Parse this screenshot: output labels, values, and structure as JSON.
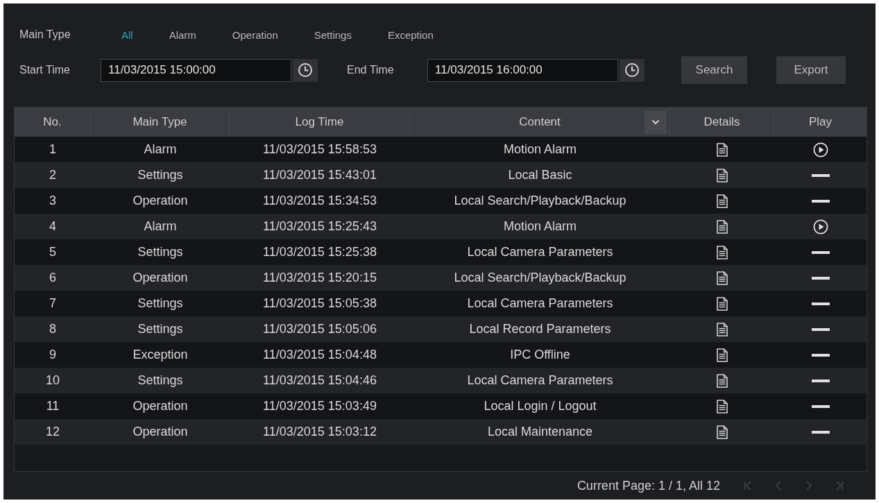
{
  "filter": {
    "label": "Main Type",
    "options": [
      {
        "label": "All",
        "selected": true
      },
      {
        "label": "Alarm",
        "selected": false
      },
      {
        "label": "Operation",
        "selected": false
      },
      {
        "label": "Settings",
        "selected": false
      },
      {
        "label": "Exception",
        "selected": false
      }
    ]
  },
  "time_range": {
    "start_label": "Start Time",
    "start_value": "11/03/2015 15:00:00",
    "end_label": "End Time",
    "end_value": "11/03/2015 16:00:00"
  },
  "buttons": [
    "Search",
    "Export"
  ],
  "table": {
    "columns": [
      {
        "label": "No.",
        "dropdown": false
      },
      {
        "label": "Main Type",
        "dropdown": false
      },
      {
        "label": "Log Time",
        "dropdown": false
      },
      {
        "label": "Content",
        "dropdown": true
      },
      {
        "label": "Details",
        "dropdown": false
      },
      {
        "label": "Play",
        "dropdown": false
      }
    ],
    "rows": [
      {
        "no": "1",
        "main_type": "Alarm",
        "log_time": "11/03/2015 15:58:53",
        "content": "Motion Alarm",
        "playable": true
      },
      {
        "no": "2",
        "main_type": "Settings",
        "log_time": "11/03/2015 15:43:01",
        "content": "Local Basic",
        "playable": false
      },
      {
        "no": "3",
        "main_type": "Operation",
        "log_time": "11/03/2015 15:34:53",
        "content": "Local Search/Playback/Backup",
        "playable": false
      },
      {
        "no": "4",
        "main_type": "Alarm",
        "log_time": "11/03/2015 15:25:43",
        "content": "Motion Alarm",
        "playable": true
      },
      {
        "no": "5",
        "main_type": "Settings",
        "log_time": "11/03/2015 15:25:38",
        "content": "Local Camera Parameters",
        "playable": false
      },
      {
        "no": "6",
        "main_type": "Operation",
        "log_time": "11/03/2015 15:20:15",
        "content": "Local Search/Playback/Backup",
        "playable": false
      },
      {
        "no": "7",
        "main_type": "Settings",
        "log_time": "11/03/2015 15:05:38",
        "content": "Local Camera Parameters",
        "playable": false
      },
      {
        "no": "8",
        "main_type": "Settings",
        "log_time": "11/03/2015 15:05:06",
        "content": "Local Record Parameters",
        "playable": false
      },
      {
        "no": "9",
        "main_type": "Exception",
        "log_time": "11/03/2015 15:04:48",
        "content": "IPC Offline",
        "playable": false
      },
      {
        "no": "10",
        "main_type": "Settings",
        "log_time": "11/03/2015 15:04:46",
        "content": "Local Camera Parameters",
        "playable": false
      },
      {
        "no": "11",
        "main_type": "Operation",
        "log_time": "11/03/2015 15:03:49",
        "content": "Local Login / Logout",
        "playable": false
      },
      {
        "no": "12",
        "main_type": "Operation",
        "log_time": "11/03/2015 15:03:12",
        "content": "Local Maintenance",
        "playable": false
      }
    ]
  },
  "pagination": {
    "text": "Current Page: 1 / 1, All 12",
    "pager_buttons": [
      {
        "kind": "first",
        "disabled": true
      },
      {
        "kind": "previous",
        "disabled": true
      },
      {
        "kind": "next",
        "disabled": true
      },
      {
        "kind": "last",
        "disabled": true
      }
    ]
  }
}
